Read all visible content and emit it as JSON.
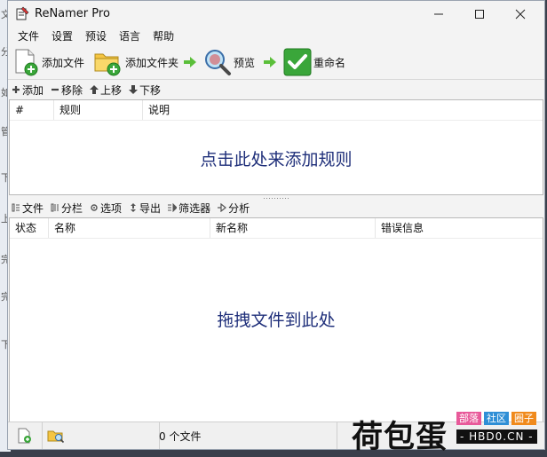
{
  "window": {
    "title": "ReNamer Pro"
  },
  "menu": [
    "文件",
    "设置",
    "预设",
    "语言",
    "帮助"
  ],
  "toolbar": {
    "add_files": "添加文件",
    "add_folder": "添加文件夹",
    "preview": "预览",
    "rename": "重命名"
  },
  "rules_bar": {
    "add": "添加",
    "remove": "移除",
    "up": "上移",
    "down": "下移"
  },
  "rules_table": {
    "columns": [
      "#",
      "规则",
      "说明"
    ],
    "empty_hint": "点击此处来添加规则"
  },
  "files_bar": {
    "files": "文件",
    "columns": "分栏",
    "options": "选项",
    "export": "导出",
    "filter": "筛选器",
    "analyze": "分析"
  },
  "files_table": {
    "columns": [
      "状态",
      "名称",
      "新名称",
      "错误信息"
    ],
    "empty_hint": "拖拽文件到此处"
  },
  "status": {
    "count_text": "0 个文件"
  },
  "watermark": {
    "main": "荷包蛋",
    "tags": [
      "部落",
      "社区",
      "圈子"
    ],
    "url": "- HBD0.CN -"
  },
  "colors": {
    "hint_text": "#1f2f7a",
    "rename_green": "#3aa63a",
    "arrow_green": "#5bbf3a",
    "tag_colors": [
      "#e85a9a",
      "#2f8fd6",
      "#f08a1c"
    ]
  }
}
